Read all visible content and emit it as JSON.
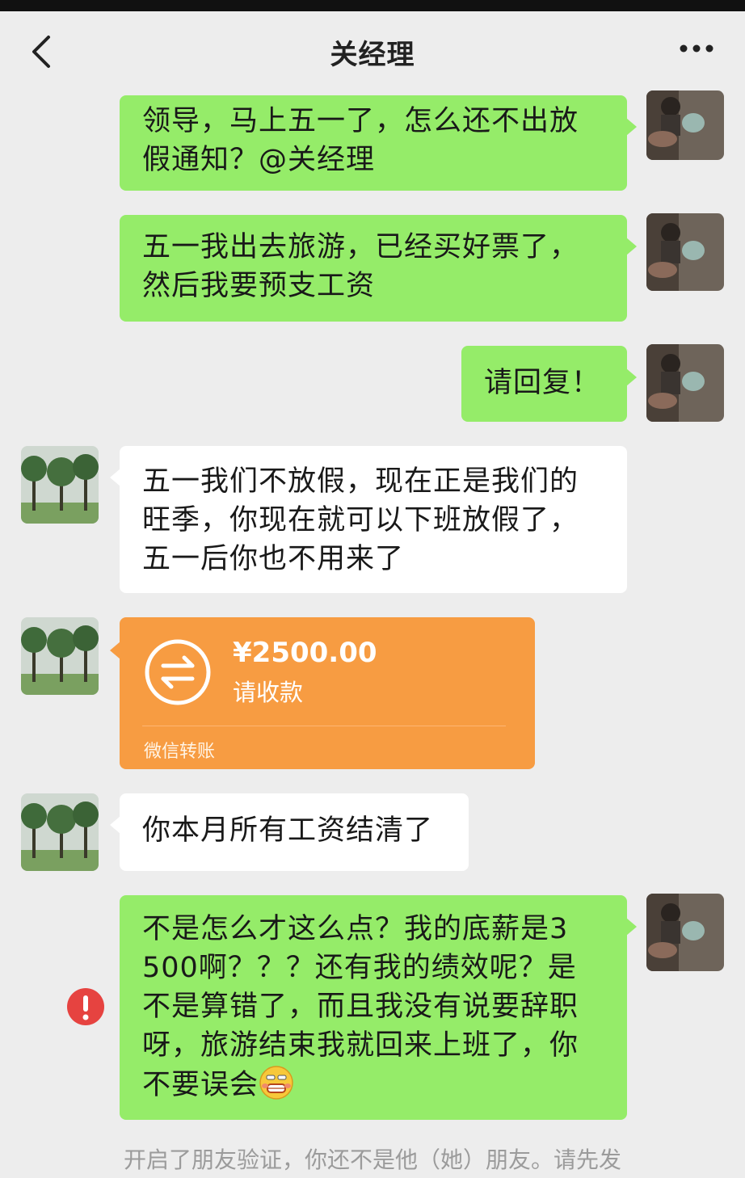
{
  "header": {
    "title": "关经理",
    "back_icon": "chevron-left-icon",
    "more_icon": "more-dots-icon"
  },
  "messages": [
    {
      "from": "me",
      "lines": [
        "领导，马上五一了，怎么还不出放",
        "假通知？@关经理"
      ]
    },
    {
      "from": "me",
      "lines": [
        "五一我出去旅游，已经买好票了，",
        "然后我要预支工资"
      ]
    },
    {
      "from": "me",
      "lines": [
        "请回复！"
      ]
    },
    {
      "from": "other",
      "lines": [
        "五一我们不放假，现在正是我们的",
        "旺季，你现在就可以下班放假了，",
        "五一后你也不用来了"
      ]
    },
    {
      "from": "other",
      "type": "transfer",
      "amount": "¥2500.00",
      "note": "请收款",
      "label": "微信转账"
    },
    {
      "from": "other",
      "lines": [
        "你本月所有工资结清了"
      ]
    },
    {
      "from": "me",
      "status": "failed",
      "lines": [
        "不是怎么才这么点？我的底薪是3",
        "500啊？？？还有我的绩效呢？是",
        "不是算错了，而且我没有说要辞职",
        "呀，旅游结束我就回来上班了，你",
        "不要误会"
      ],
      "emoji": "grimace-emoji"
    }
  ],
  "system_notice": "开启了朋友验证，你还不是他（她）朋友。请先发",
  "colors": {
    "background": "#ededed",
    "my_bubble": "#95ec69",
    "other_bubble": "#ffffff",
    "transfer": "#f79c42",
    "failed": "#e64340"
  }
}
